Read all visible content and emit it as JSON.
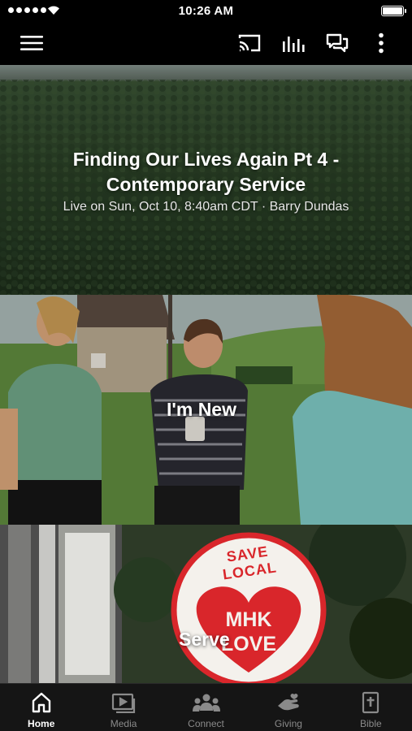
{
  "status_bar": {
    "time": "10:26 AM",
    "signal_icon": "signal-dots-icon",
    "wifi_icon": "wifi-icon",
    "battery_icon": "battery-icon",
    "battery_level": 1.0
  },
  "app_bar": {
    "menu_icon": "hamburger-menu-icon",
    "cast_icon": "cast-icon",
    "audio_icon": "audio-bars-icon",
    "chat_icon": "chat-icon",
    "more_icon": "more-vertical-icon"
  },
  "featured": {
    "title_line1": "Finding Our Lives Again Pt 4 -",
    "title_line2": "Contemporary Service",
    "subtitle": "Live on Sun, Oct 10, 8:40am CDT · Barry Dundas"
  },
  "cards": [
    {
      "label": "I'm New"
    },
    {
      "label": "Serve",
      "sign_top": "SAVE LOCAL",
      "sign_line1": "MHK",
      "sign_line2": "LOVE"
    }
  ],
  "tabs": [
    {
      "label": "Home",
      "icon": "home-icon",
      "active": true
    },
    {
      "label": "Media",
      "icon": "media-play-icon",
      "active": false
    },
    {
      "label": "Connect",
      "icon": "people-icon",
      "active": false
    },
    {
      "label": "Giving",
      "icon": "giving-hand-icon",
      "active": false
    },
    {
      "label": "Bible",
      "icon": "bible-icon",
      "active": false
    }
  ],
  "colors": {
    "background": "#000000",
    "tab_bar": "#151515",
    "tab_inactive": "#8a8a8a",
    "tab_active": "#ffffff",
    "heart_red": "#d9262b"
  }
}
